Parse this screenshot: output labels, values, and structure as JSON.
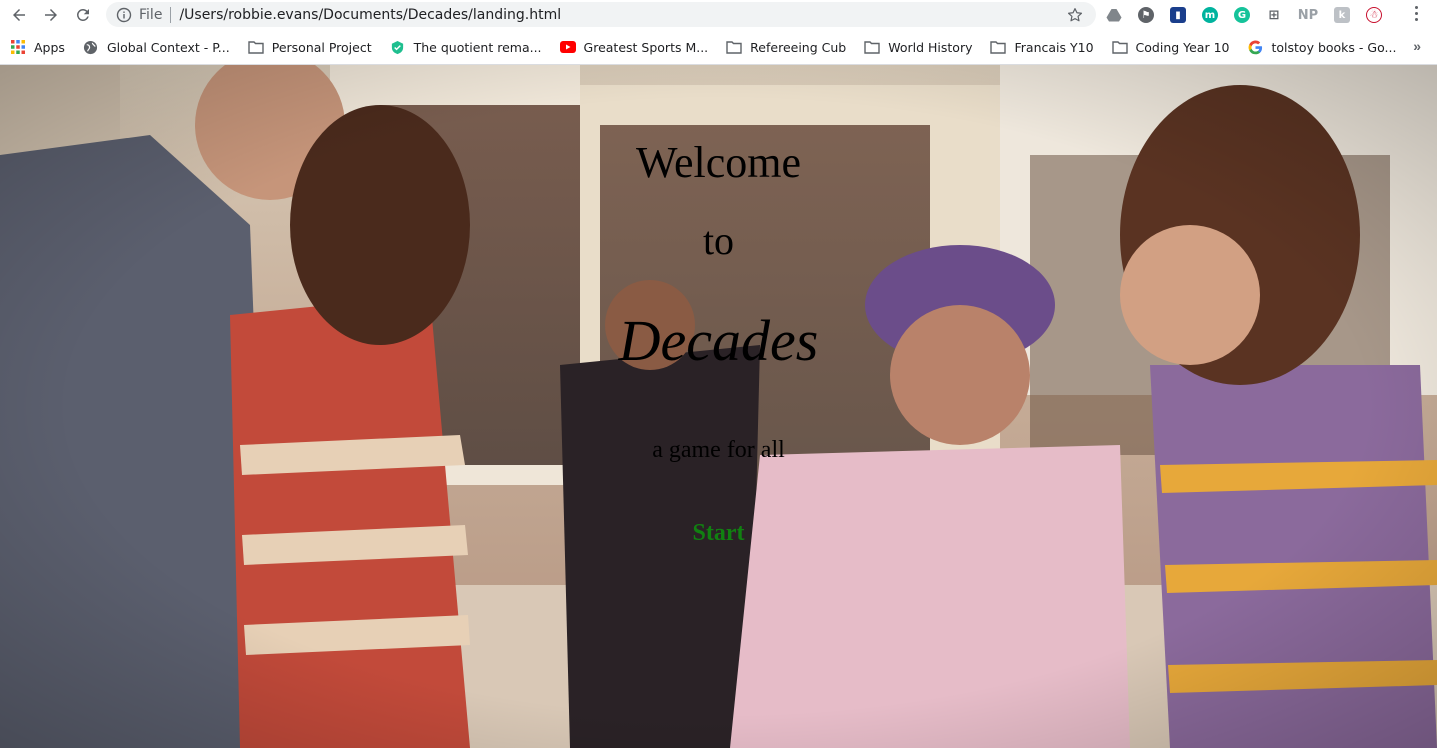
{
  "toolbar": {
    "scheme": "File",
    "url": "/Users/robbie.evans/Documents/Decades/landing.html",
    "nav_icons": [
      "back-arrow-icon",
      "forward-arrow-icon",
      "reload-icon"
    ],
    "extensions": [
      "drive-icon",
      "vpn-icon",
      "bookmark-ext-icon",
      "m-ext-icon",
      "grammarly-icon",
      "grid-ext-icon",
      "np-ext-icon",
      "k-ext-icon",
      "profile-avatar-icon"
    ],
    "extension_np_label": "NP"
  },
  "bookmarks": [
    {
      "label": "Apps",
      "icon": "apps-grid-icon"
    },
    {
      "label": "Global Context - P...",
      "icon": "globe-icon"
    },
    {
      "label": "Personal Project",
      "icon": "folder-icon"
    },
    {
      "label": "The quotient rema...",
      "icon": "shield-site-icon"
    },
    {
      "label": "Greatest Sports M...",
      "icon": "youtube-icon"
    },
    {
      "label": "Refereeing Cub",
      "icon": "folder-icon"
    },
    {
      "label": "World History",
      "icon": "folder-icon"
    },
    {
      "label": "Francais Y10",
      "icon": "folder-icon"
    },
    {
      "label": "Coding Year 10",
      "icon": "folder-icon"
    },
    {
      "label": "tolstoy books - Go...",
      "icon": "google-icon"
    }
  ],
  "bookmarks_more": "»",
  "page": {
    "welcome": "Welcome",
    "to": "to",
    "title": "Decades",
    "tagline": "a game for all",
    "start": "Start",
    "start_color": "#118011"
  }
}
